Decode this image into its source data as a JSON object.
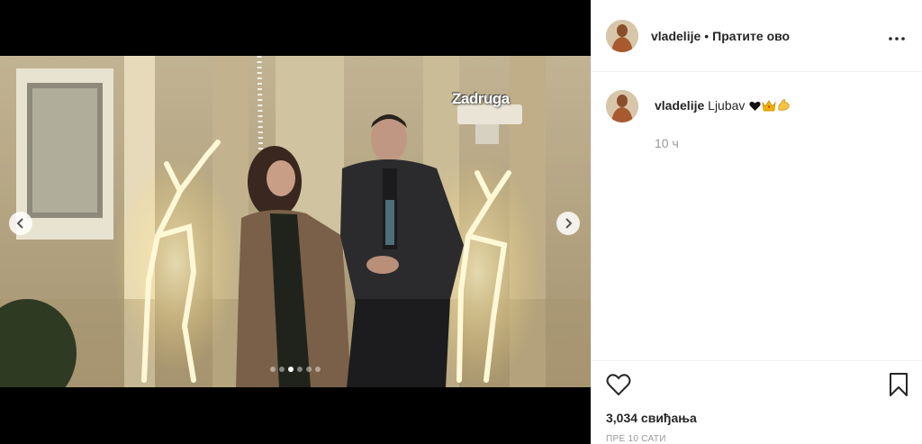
{
  "post": {
    "watermark": "Zadruga",
    "slides_total": 6,
    "active_slide": 2
  },
  "header": {
    "username": "vladelije",
    "separator": "•",
    "follow_label": "Пратите ово",
    "more_icon": "more-horizontal-icon"
  },
  "comment": {
    "username": "vladelije",
    "text": "Ljubav",
    "emojis": [
      "black-heart-icon",
      "crown-icon",
      "flexed-biceps-icon"
    ],
    "time": "10 ч"
  },
  "actions": {
    "like_icon": "heart-outline-icon",
    "save_icon": "bookmark-outline-icon",
    "likes": "3,034 свиђања",
    "posted": "ПРЕ 10 САТИ"
  },
  "colors": {
    "text": "#262626",
    "muted": "#999999",
    "border": "#efefef",
    "media_bg": "#000000"
  }
}
